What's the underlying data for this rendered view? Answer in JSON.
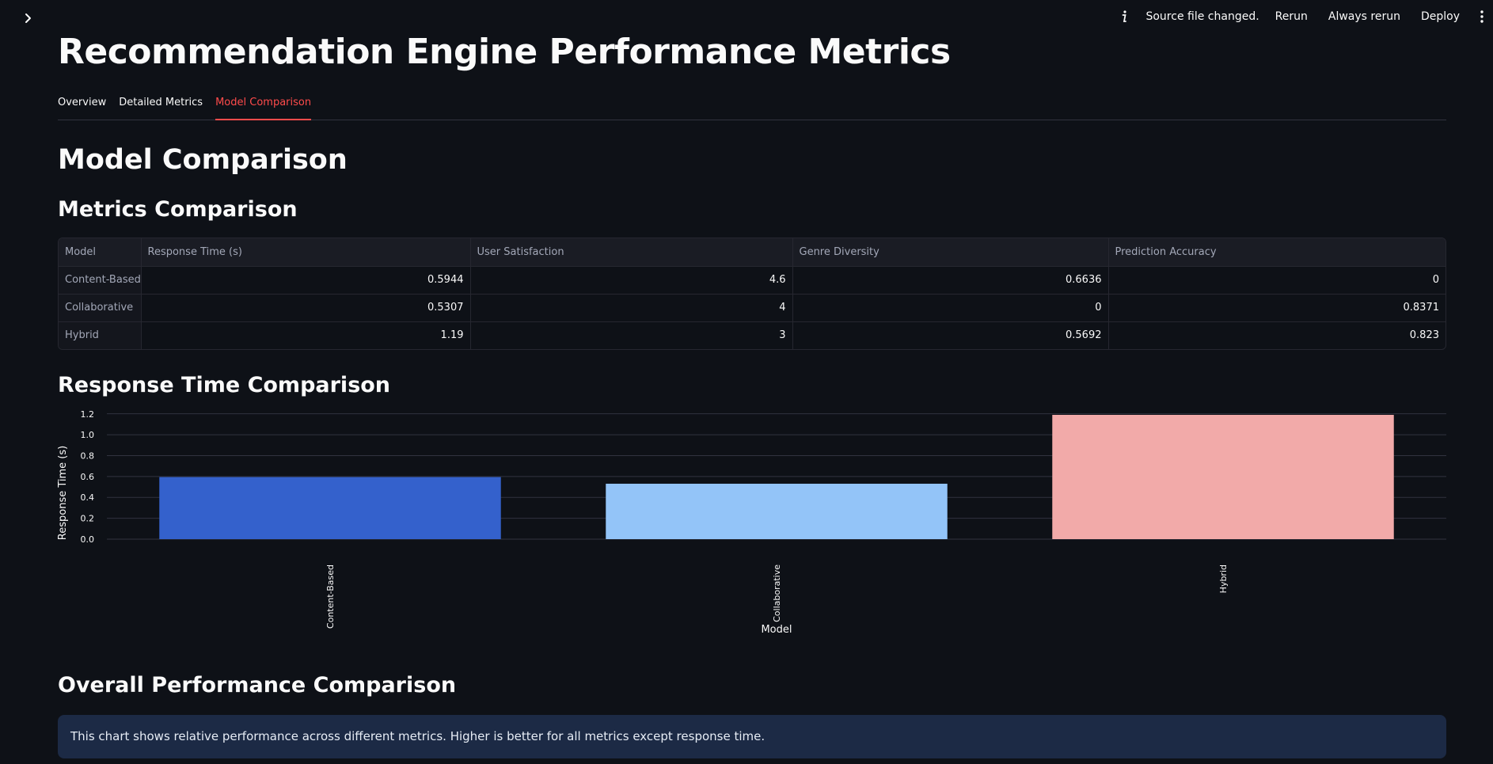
{
  "header": {
    "status_text": "Source file changed.",
    "rerun_label": "Rerun",
    "always_rerun_label": "Always rerun",
    "deploy_label": "Deploy"
  },
  "page_title": "Recommendation Engine Performance Metrics",
  "tabs": [
    {
      "label": "Overview",
      "active": false
    },
    {
      "label": "Detailed Metrics",
      "active": false
    },
    {
      "label": "Model Comparison",
      "active": true
    }
  ],
  "section_title": "Model Comparison",
  "metrics": {
    "title": "Metrics Comparison",
    "columns": [
      "Model",
      "Response Time (s)",
      "User Satisfaction",
      "Genre Diversity",
      "Prediction Accuracy"
    ],
    "rows": [
      [
        "Content-Based",
        "0.5944",
        "4.6",
        "0.6636",
        "0"
      ],
      [
        "Collaborative",
        "0.5307",
        "4",
        "0",
        "0.8371"
      ],
      [
        "Hybrid",
        "1.19",
        "3",
        "0.5692",
        "0.823"
      ]
    ]
  },
  "response_chart": {
    "title": "Response Time Comparison"
  },
  "chart_data": {
    "type": "bar",
    "categories": [
      "Content-Based",
      "Collaborative",
      "Hybrid"
    ],
    "values": [
      0.5944,
      0.5307,
      1.19
    ],
    "colors": [
      "#3461cc",
      "#93c4f8",
      "#f2aaa9"
    ],
    "xlabel": "Model",
    "ylabel": "Response Time (s)",
    "ylim": [
      0,
      1.19
    ],
    "yticks": [
      "0.0",
      "0.2",
      "0.4",
      "0.6",
      "0.8",
      "1.0",
      "1.2"
    ],
    "grid": true
  },
  "overall": {
    "title": "Overall Performance Comparison",
    "info": "This chart shows relative performance across different metrics. Higher is better for all metrics except response time."
  },
  "colors": {
    "background": "#0e1117",
    "accent": "#ff4b4b",
    "info_bg": "#1c2a45"
  }
}
